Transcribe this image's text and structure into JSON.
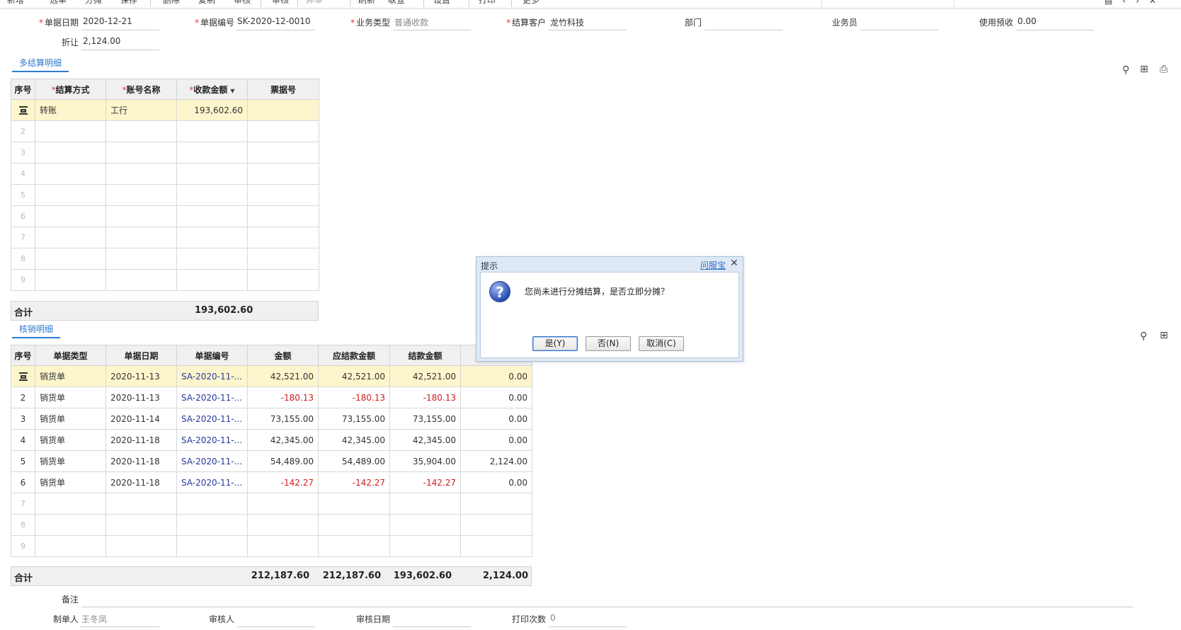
{
  "toolbar": {
    "items": [
      "新增",
      "选单",
      "分摊",
      "保存",
      "删除",
      "复制",
      "审核",
      "审核",
      "弃审",
      "刷新",
      "联查",
      "设置",
      "打印",
      "更多"
    ]
  },
  "header": {
    "date_label": "单据日期",
    "date_value": "2020-12-21",
    "code_label": "单据编号",
    "code_value": "SK-2020-12-0010",
    "biztype_label": "业务类型",
    "biztype_value": "普通收款",
    "customer_label": "结算客户",
    "customer_value": "龙竹科技",
    "dept_label": "部门",
    "dept_value": "",
    "sales_label": "业务员",
    "sales_value": "",
    "prepay_label": "使用预收",
    "prepay_value": "0.00",
    "discount_label": "折让",
    "discount_value": "2,124.00"
  },
  "settle": {
    "tab_label": "多结算明细",
    "columns": [
      "序号",
      "结算方式",
      "账号名称",
      "收款金额",
      "票据号"
    ],
    "rows": [
      {
        "idx": "",
        "method": "转账",
        "account": "工行",
        "amount": "193,602.60",
        "bill": ""
      },
      {
        "idx": "2"
      },
      {
        "idx": "3"
      },
      {
        "idx": "4"
      },
      {
        "idx": "5"
      },
      {
        "idx": "6"
      },
      {
        "idx": "7"
      },
      {
        "idx": "8"
      },
      {
        "idx": "9"
      }
    ],
    "total_label": "合计",
    "total_amount": "193,602.60"
  },
  "writeoff": {
    "tab_label": "核销明细",
    "columns": [
      "序号",
      "单据类型",
      "单据日期",
      "单据编号",
      "金额",
      "应结款金额",
      "结款金额",
      ""
    ],
    "rows": [
      {
        "idx": "",
        "type": "销货单",
        "date": "2020-11-13",
        "code": "SA-2020-11-...",
        "amount": "42,521.00",
        "due": "42,521.00",
        "paid": "42,521.00",
        "disc": "0.00",
        "neg": false
      },
      {
        "idx": "2",
        "type": "销货单",
        "date": "2020-11-13",
        "code": "SA-2020-11-...",
        "amount": "-180.13",
        "due": "-180.13",
        "paid": "-180.13",
        "disc": "0.00",
        "neg": true
      },
      {
        "idx": "3",
        "type": "销货单",
        "date": "2020-11-14",
        "code": "SA-2020-11-...",
        "amount": "73,155.00",
        "due": "73,155.00",
        "paid": "73,155.00",
        "disc": "0.00",
        "neg": false
      },
      {
        "idx": "4",
        "type": "销货单",
        "date": "2020-11-18",
        "code": "SA-2020-11-...",
        "amount": "42,345.00",
        "due": "42,345.00",
        "paid": "42,345.00",
        "disc": "0.00",
        "neg": false
      },
      {
        "idx": "5",
        "type": "销货单",
        "date": "2020-11-18",
        "code": "SA-2020-11-...",
        "amount": "54,489.00",
        "due": "54,489.00",
        "paid": "35,904.00",
        "disc": "2,124.00",
        "neg": false
      },
      {
        "idx": "6",
        "type": "销货单",
        "date": "2020-11-18",
        "code": "SA-2020-11-...",
        "amount": "-142.27",
        "due": "-142.27",
        "paid": "-142.27",
        "disc": "0.00",
        "neg": true
      },
      {
        "idx": "7"
      },
      {
        "idx": "8"
      },
      {
        "idx": "9"
      }
    ],
    "total_label": "合计",
    "total_amount": "212,187.60",
    "total_due": "212,187.60",
    "total_paid": "193,602.60",
    "total_disc": "2,124.00"
  },
  "footer": {
    "remark_label": "备注",
    "remark_value": "",
    "creator_label": "制单人",
    "creator_value": "王冬凤",
    "auditor_label": "审核人",
    "auditor_value": "",
    "audit_date_label": "审核日期",
    "audit_date_value": "",
    "print_label": "打印次数",
    "print_value": "0"
  },
  "dialog": {
    "title": "提示",
    "help": "问服宝",
    "message": "您尚未进行分摊结算，是否立即分摊？",
    "yes": "是(Y)",
    "no": "否(N)",
    "cancel": "取消(C)"
  },
  "colors": {
    "accent": "#2f7bd0",
    "negative": "#d01b1b",
    "selected_row": "#fdf6cc",
    "link": "#26389a"
  }
}
